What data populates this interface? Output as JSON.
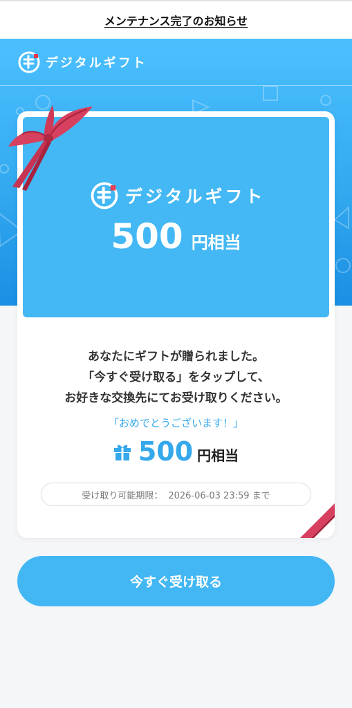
{
  "notice": {
    "link_text": "メンテナンス完了のお知らせ"
  },
  "header": {
    "logo_text": "デジタルギフト"
  },
  "giftbox": {
    "logo_text": "デジタルギフト",
    "amount": "500",
    "unit": "円相当"
  },
  "message": {
    "line1": "あなたにギフトが贈られました。",
    "line2": "「今すぐ受け取る」をタップして、",
    "line3": "お好きな交換先にてお受け取りください。"
  },
  "congrats": "「おめでとうございます！」",
  "amount": {
    "value": "500",
    "unit": "円相当",
    "icon": "gift-icon"
  },
  "deadline": {
    "label": "受け取り可能期限：",
    "value": "2026-06-03 23:59 まで"
  },
  "cta": {
    "label": "今すぐ受け取る"
  },
  "colors": {
    "brand_blue": "#42b7f4",
    "ribbon": "#d7405e",
    "logo_accent": "#e8394f",
    "background": "#f5f6f8"
  }
}
